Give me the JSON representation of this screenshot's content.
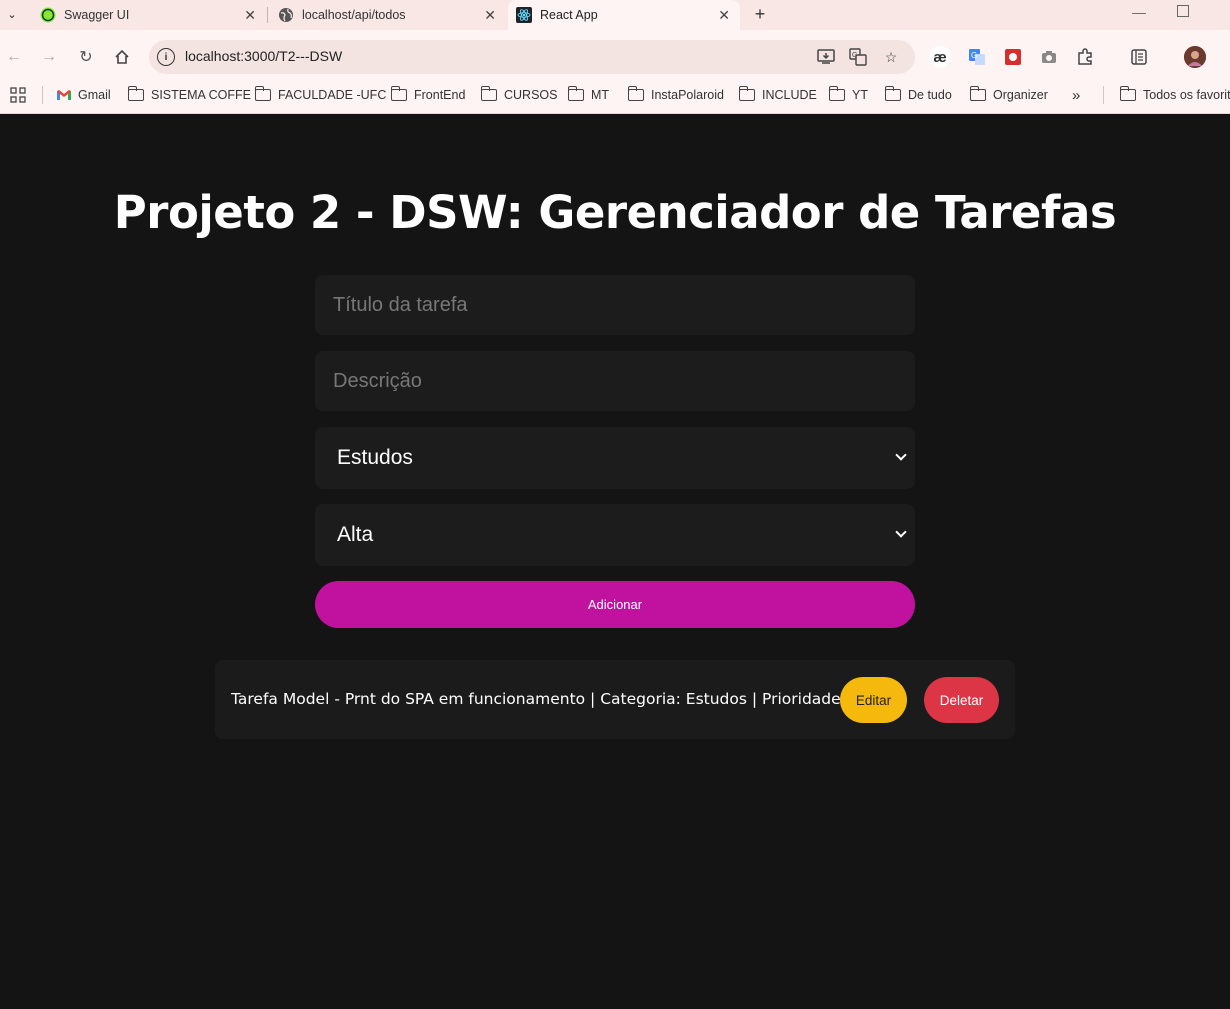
{
  "browser": {
    "tabs": [
      {
        "label": "Swagger UI",
        "icon": "swagger-icon"
      },
      {
        "label": "localhost/api/todos",
        "icon": "globe-icon"
      },
      {
        "label": "React App",
        "icon": "react-icon",
        "active": true
      }
    ],
    "url": "localhost:3000/T2---DSW",
    "bookmarks": [
      "Gmail",
      "SISTEMA COFFE",
      "FACULDADE -UFC",
      "FrontEnd",
      "CURSOS",
      "MT",
      "InstaPolaroid",
      "INCLUDE",
      "YT",
      "De tudo",
      "Organizer"
    ],
    "all_bookmarks_label": "Todos os favorito"
  },
  "app": {
    "title": "Projeto 2 - DSW: Gerenciador de Tarefas",
    "form": {
      "title_placeholder": "Título da tarefa",
      "description_placeholder": "Descrição",
      "category_value": "Estudos",
      "priority_value": "Alta",
      "add_label": "Adicionar"
    },
    "tasks": [
      {
        "text": "Tarefa Model - Prnt do SPA em funcionamento | Categoria: Estudos | Prioridade: Alta",
        "edit_label": "Editar",
        "delete_label": "Deletar"
      }
    ]
  },
  "colors": {
    "background": "#141414",
    "accent": "#c0129e",
    "edit": "#f5b80c",
    "delete": "#dc3545"
  }
}
